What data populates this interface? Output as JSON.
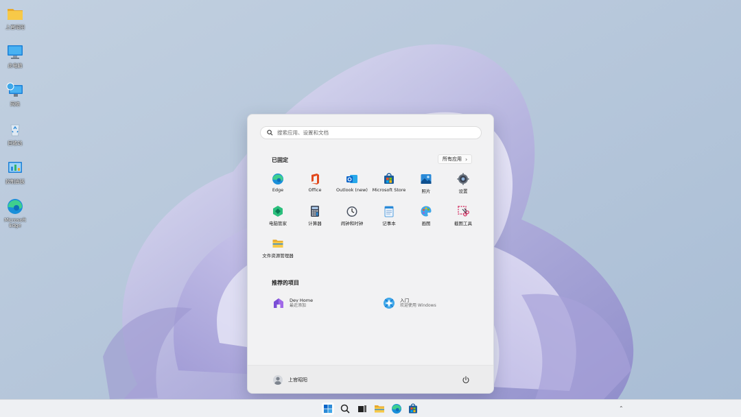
{
  "desktop": {
    "icons": [
      {
        "label": "上官昭阳",
        "icon": "folder-icon"
      },
      {
        "label": "此电脑",
        "icon": "computer-icon"
      },
      {
        "label": "网络",
        "icon": "network-icon"
      },
      {
        "label": "回收站",
        "icon": "recycle-bin-icon"
      },
      {
        "label": "控制面板",
        "icon": "control-panel-icon"
      },
      {
        "label": "Microsoft Edge",
        "icon": "edge-icon"
      }
    ]
  },
  "start_menu": {
    "search_placeholder": "搜索应用、设置和文档",
    "pinned_title": "已固定",
    "all_apps_label": "所有应用",
    "pinned": [
      {
        "label": "Edge",
        "icon": "edge-icon"
      },
      {
        "label": "Office",
        "icon": "office-icon"
      },
      {
        "label": "Outlook (new)",
        "icon": "outlook-icon"
      },
      {
        "label": "Microsoft Store",
        "icon": "store-icon"
      },
      {
        "label": "照片",
        "icon": "photos-icon"
      },
      {
        "label": "设置",
        "icon": "settings-icon"
      },
      {
        "label": "电脑管家",
        "icon": "pc-manager-icon"
      },
      {
        "label": "计算器",
        "icon": "calculator-icon"
      },
      {
        "label": "闹钟和时钟",
        "icon": "clock-icon"
      },
      {
        "label": "记事本",
        "icon": "notepad-icon"
      },
      {
        "label": "画图",
        "icon": "paint-icon"
      },
      {
        "label": "截图工具",
        "icon": "snipping-tool-icon"
      },
      {
        "label": "文件资源管理器",
        "icon": "file-explorer-icon"
      }
    ],
    "recommended_title": "推荐的项目",
    "recommended": [
      {
        "name": "Dev Home",
        "sub": "最近添加",
        "icon": "dev-home-icon"
      },
      {
        "name": "入门",
        "sub": "欢迎使用 Windows",
        "icon": "get-started-icon"
      }
    ],
    "user_name": "上官昭阳"
  },
  "taskbar": {
    "items": [
      "start-icon",
      "search-icon",
      "task-view-icon",
      "file-explorer-icon",
      "edge-icon",
      "store-icon"
    ]
  },
  "colors": {
    "wallpaper_bg": "#b9c9dc",
    "accent": "#0a64c8"
  }
}
